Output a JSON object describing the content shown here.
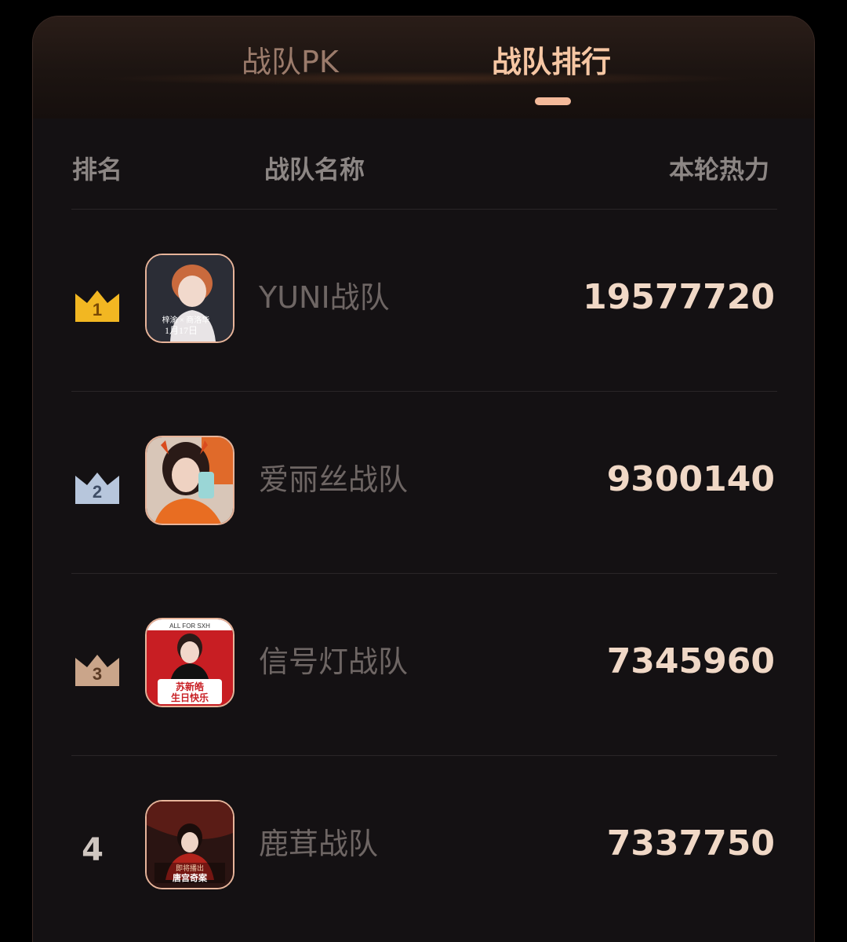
{
  "tabs": [
    {
      "label": "战队PK",
      "active": false
    },
    {
      "label": "战队排行",
      "active": true
    }
  ],
  "header": {
    "rank": "排名",
    "name": "战队名称",
    "heat": "本轮热力"
  },
  "rows": [
    {
      "rank": "1",
      "team": "YUNI战队",
      "heat": "19577720",
      "crown": "gold",
      "avatar_text": [
        "梓渝 × 商洛华",
        "1月17日"
      ]
    },
    {
      "rank": "2",
      "team": "爱丽丝战队",
      "heat": "9300140",
      "crown": "silver",
      "avatar_text": []
    },
    {
      "rank": "3",
      "team": "信号灯战队",
      "heat": "7345960",
      "crown": "bronze",
      "avatar_text": [
        "ALL FOR SXH",
        "苏新皓",
        "生日快乐"
      ]
    },
    {
      "rank": "4",
      "team": "鹿茸战队",
      "heat": "7337750",
      "crown": "none",
      "avatar_text": [
        "即将播出",
        "唐宫奇案"
      ]
    }
  ],
  "colors": {
    "gold": "#f2b722",
    "silver": "#b7c6dc",
    "bronze": "#caa58a",
    "accent": "#f6c6a3"
  }
}
